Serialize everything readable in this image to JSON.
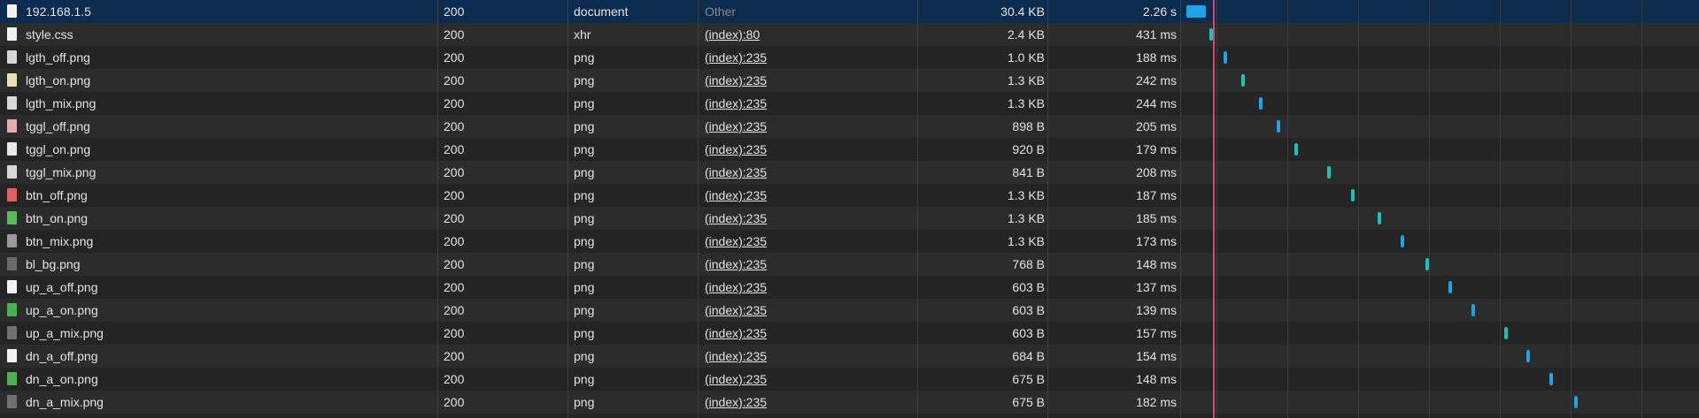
{
  "network": {
    "rows": [
      {
        "name": "192.168.1.5",
        "status": "200",
        "type": "document",
        "initiator": "Other",
        "initiator_link": false,
        "size": "30.4 KB",
        "time": "2.26 s",
        "icon": "document-icon",
        "icon_color": "#f2f2f2",
        "bar": "blue",
        "selected": true
      },
      {
        "name": "style.css",
        "status": "200",
        "type": "xhr",
        "initiator": "(index):80",
        "initiator_link": true,
        "size": "2.4 KB",
        "time": "431 ms",
        "icon": "file-icon",
        "icon_color": "#f2f2f2",
        "bar": "teal"
      },
      {
        "name": "lgth_off.png",
        "status": "200",
        "type": "png",
        "initiator": "(index):235",
        "initiator_link": true,
        "size": "1.0 KB",
        "time": "188 ms",
        "icon": "light-off-icon",
        "icon_color": "#d8d8d8",
        "bar": "blue"
      },
      {
        "name": "lgth_on.png",
        "status": "200",
        "type": "png",
        "initiator": "(index):235",
        "initiator_link": true,
        "size": "1.3 KB",
        "time": "242 ms",
        "icon": "light-on-icon",
        "icon_color": "#e8e0b0",
        "bar": "teal"
      },
      {
        "name": "lgth_mix.png",
        "status": "200",
        "type": "png",
        "initiator": "(index):235",
        "initiator_link": true,
        "size": "1.3 KB",
        "time": "244 ms",
        "icon": "light-mix-icon",
        "icon_color": "#d8d8d8",
        "bar": "blue"
      },
      {
        "name": "tggl_off.png",
        "status": "200",
        "type": "png",
        "initiator": "(index):235",
        "initiator_link": true,
        "size": "898 B",
        "time": "205 ms",
        "icon": "toggle-off-icon",
        "icon_color": "#e0b0b0",
        "bar": "blue"
      },
      {
        "name": "tggl_on.png",
        "status": "200",
        "type": "png",
        "initiator": "(index):235",
        "initiator_link": true,
        "size": "920 B",
        "time": "179 ms",
        "icon": "toggle-on-icon",
        "icon_color": "#e8e8e8",
        "bar": "teal"
      },
      {
        "name": "tggl_mix.png",
        "status": "200",
        "type": "png",
        "initiator": "(index):235",
        "initiator_link": true,
        "size": "841 B",
        "time": "208 ms",
        "icon": "toggle-mix-icon",
        "icon_color": "#d8d8d8",
        "bar": "teal"
      },
      {
        "name": "btn_off.png",
        "status": "200",
        "type": "png",
        "initiator": "(index):235",
        "initiator_link": true,
        "size": "1.3 KB",
        "time": "187 ms",
        "icon": "button-off-icon",
        "icon_color": "#e06060",
        "bar": "teal"
      },
      {
        "name": "btn_on.png",
        "status": "200",
        "type": "png",
        "initiator": "(index):235",
        "initiator_link": true,
        "size": "1.3 KB",
        "time": "185 ms",
        "icon": "button-on-icon",
        "icon_color": "#5fb85f",
        "bar": "teal"
      },
      {
        "name": "btn_mix.png",
        "status": "200",
        "type": "png",
        "initiator": "(index):235",
        "initiator_link": true,
        "size": "1.3 KB",
        "time": "173 ms",
        "icon": "button-mix-icon",
        "icon_color": "#9a9a9a",
        "bar": "blue"
      },
      {
        "name": "bl_bg.png",
        "status": "200",
        "type": "png",
        "initiator": "(index):235",
        "initiator_link": true,
        "size": "768 B",
        "time": "148 ms",
        "icon": "image-icon",
        "icon_color": "#6a6a6a",
        "bar": "teal"
      },
      {
        "name": "up_a_off.png",
        "status": "200",
        "type": "png",
        "initiator": "(index):235",
        "initiator_link": true,
        "size": "603 B",
        "time": "137 ms",
        "icon": "file-icon",
        "icon_color": "#f2f2f2",
        "bar": "blue"
      },
      {
        "name": "up_a_on.png",
        "status": "200",
        "type": "png",
        "initiator": "(index):235",
        "initiator_link": true,
        "size": "603 B",
        "time": "139 ms",
        "icon": "arrow-up-on-icon",
        "icon_color": "#4caf50",
        "bar": "blue"
      },
      {
        "name": "up_a_mix.png",
        "status": "200",
        "type": "png",
        "initiator": "(index):235",
        "initiator_link": true,
        "size": "603 B",
        "time": "157 ms",
        "icon": "arrow-up-mix-icon",
        "icon_color": "#707070",
        "bar": "teal"
      },
      {
        "name": "dn_a_off.png",
        "status": "200",
        "type": "png",
        "initiator": "(index):235",
        "initiator_link": true,
        "size": "684 B",
        "time": "154 ms",
        "icon": "file-icon",
        "icon_color": "#f2f2f2",
        "bar": "blue"
      },
      {
        "name": "dn_a_on.png",
        "status": "200",
        "type": "png",
        "initiator": "(index):235",
        "initiator_link": true,
        "size": "675 B",
        "time": "148 ms",
        "icon": "arrow-down-on-icon",
        "icon_color": "#4caf50",
        "bar": "blue"
      },
      {
        "name": "dn_a_mix.png",
        "status": "200",
        "type": "png",
        "initiator": "(index):235",
        "initiator_link": true,
        "size": "675 B",
        "time": "182 ms",
        "icon": "arrow-down-mix-icon",
        "icon_color": "#707070",
        "bar": "blue"
      }
    ],
    "colors": {
      "selected_row": "#0b2c4f",
      "bar_blue": "#1ea3e6",
      "bar_teal": "#17c5b8",
      "load_marker": "#d6427b"
    }
  }
}
